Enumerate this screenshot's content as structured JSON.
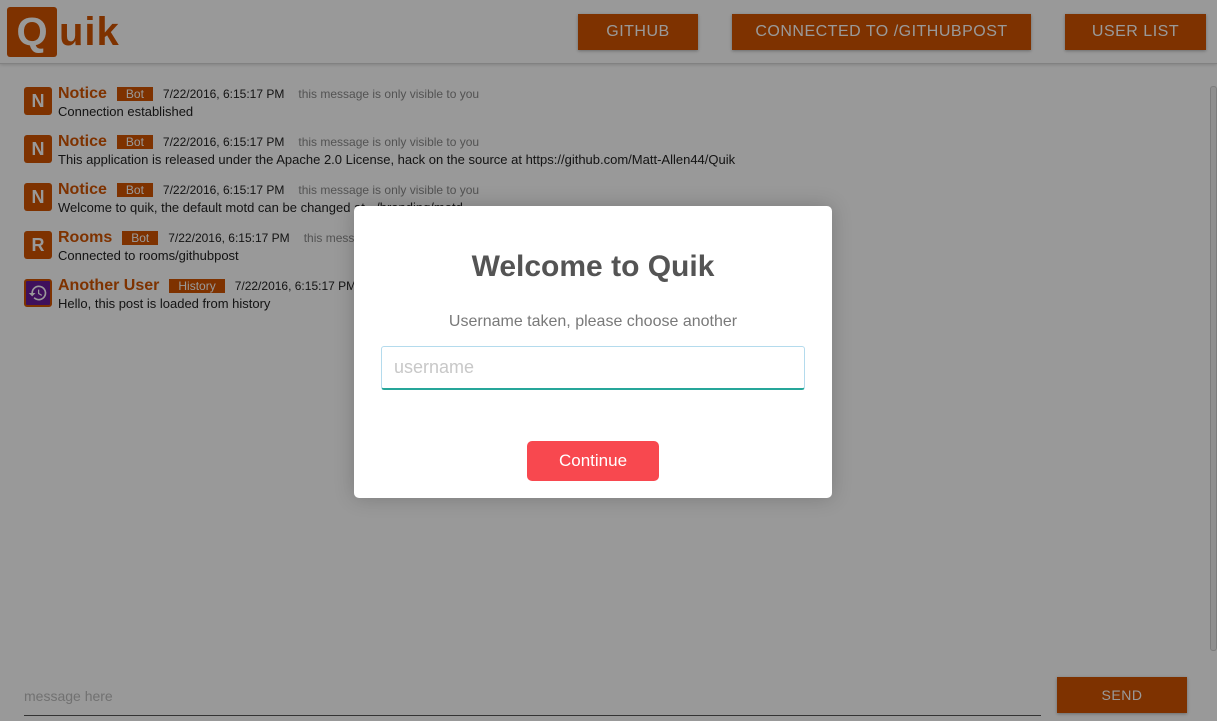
{
  "app": {
    "logo_q": "Q",
    "logo_rest": "uik",
    "brand_color": "#d35400"
  },
  "nav": {
    "github": "GITHUB",
    "room": "CONNECTED TO /GITHUBPOST",
    "users": "USER LIST"
  },
  "messages": [
    {
      "avatar_letter": "N",
      "name": "Notice",
      "tag": "Bot",
      "time": "7/22/2016, 6:15:17 PM",
      "note": "this message is only visible to you",
      "body": "Connection established"
    },
    {
      "avatar_letter": "N",
      "name": "Notice",
      "tag": "Bot",
      "time": "7/22/2016, 6:15:17 PM",
      "note": "this message is only visible to you",
      "body": "This application is released under the Apache 2.0 License, hack on the source at https://github.com/Matt-Allen44/Quik"
    },
    {
      "avatar_letter": "N",
      "name": "Notice",
      "tag": "Bot",
      "time": "7/22/2016, 6:15:17 PM",
      "note": "this message is only visible to you",
      "body": "Welcome to quik, the default motd can be changed at ~/branding/motd"
    },
    {
      "avatar_letter": "R",
      "name": "Rooms",
      "tag": "Bot",
      "time": "7/22/2016, 6:15:17 PM",
      "note": "this message is only visible to you",
      "body": "Connected to rooms/githubpost"
    },
    {
      "avatar_icon": "history-icon",
      "name": "Another User",
      "tag": "History",
      "time": "7/22/2016, 6:15:17 PM",
      "body": "Hello, this post is loaded from history"
    }
  ],
  "composer": {
    "placeholder": "message here",
    "send_label": "SEND"
  },
  "modal": {
    "title": "Welcome to Quik",
    "text": "Username taken, please choose another",
    "input_placeholder": "username",
    "continue_label": "Continue",
    "continue_color": "#f8484f"
  }
}
